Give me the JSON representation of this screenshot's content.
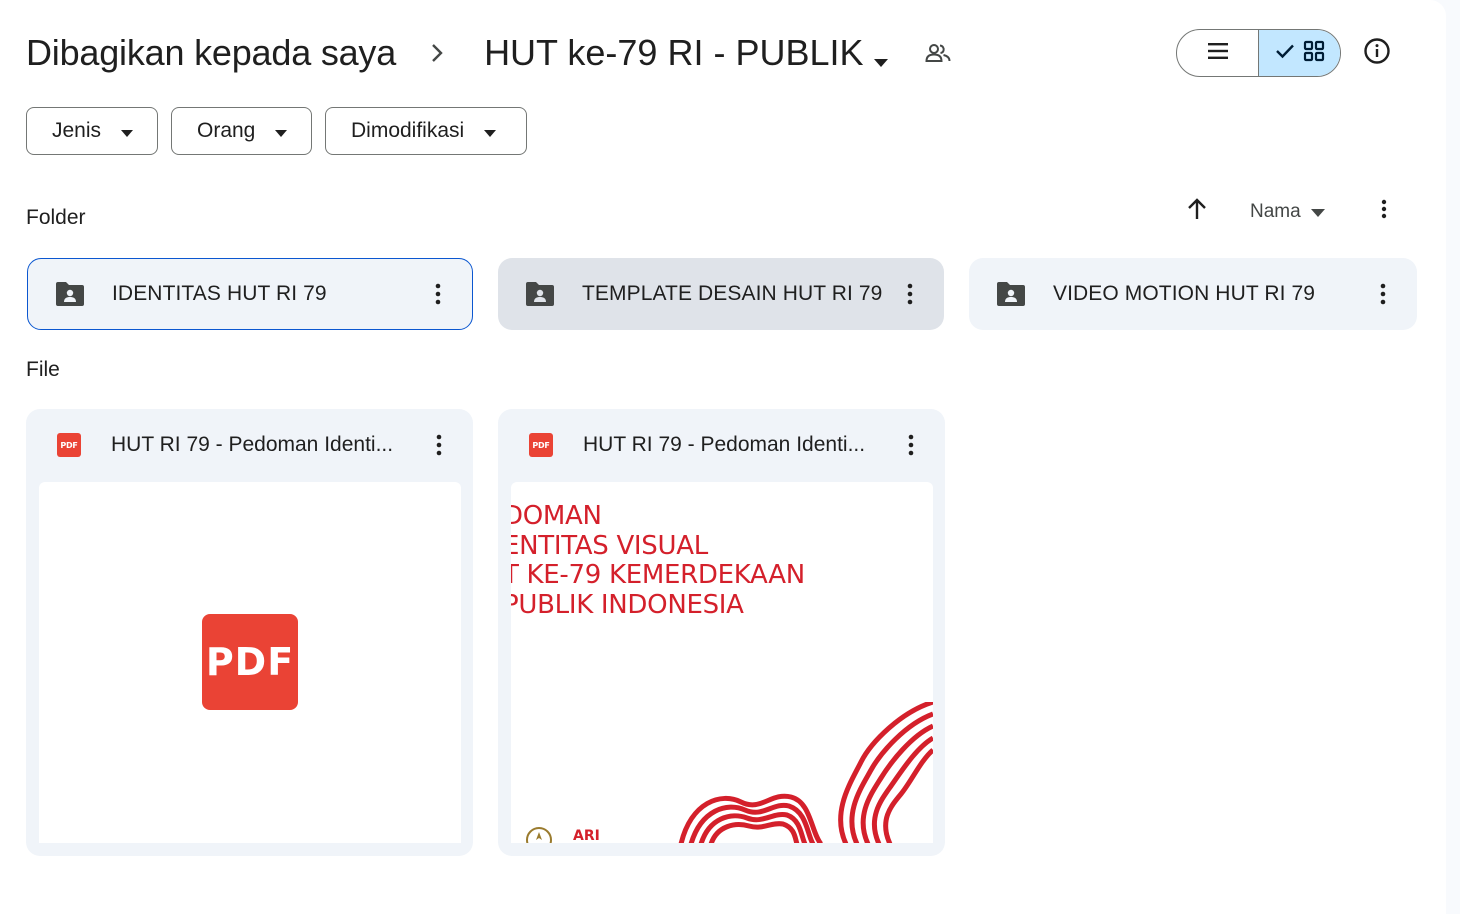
{
  "breadcrumb": {
    "root": "Dibagikan kepada saya",
    "current": "HUT ke-79 RI - PUBLIK"
  },
  "header_icons": [
    "chevron-right-icon",
    "caret-down-icon",
    "shared-people-icon",
    "list-view-icon",
    "check-icon",
    "grid-view-icon",
    "info-icon"
  ],
  "view_mode": "grid",
  "filters": [
    {
      "label": "Jenis"
    },
    {
      "label": "Orang"
    },
    {
      "label": "Dimodifikasi"
    }
  ],
  "sections": {
    "folders_label": "Folder",
    "files_label": "File"
  },
  "sort": {
    "direction": "ascending",
    "field": "Nama"
  },
  "folders": [
    {
      "name": "IDENTITAS HUT RI 79",
      "state": "selected"
    },
    {
      "name": "TEMPLATE DESAIN HUT RI 79",
      "state": "hovered"
    },
    {
      "name": "VIDEO MOTION HUT RI 79",
      "state": "normal"
    }
  ],
  "files": [
    {
      "name": "HUT RI 79 - Pedoman Identi...",
      "type_badge": "PDF",
      "preview": "generic-pdf",
      "preview_label": "PDF"
    },
    {
      "name": "HUT RI 79 - Pedoman Identi...",
      "type_badge": "PDF",
      "preview": "document-cover",
      "preview_lines": [
        "DOMAN",
        "ENTITAS VISUAL",
        "T KE-79 KEMERDEKAAN",
        "PUBLIK INDONESIA"
      ],
      "preview_logo": "ARI"
    }
  ],
  "colors": {
    "accent": "#0b57d0",
    "toggle_active": "#c2e7ff",
    "card_bg": "#f0f4f9",
    "pdf_red": "#ea4335",
    "doc_red": "#d4202b"
  }
}
